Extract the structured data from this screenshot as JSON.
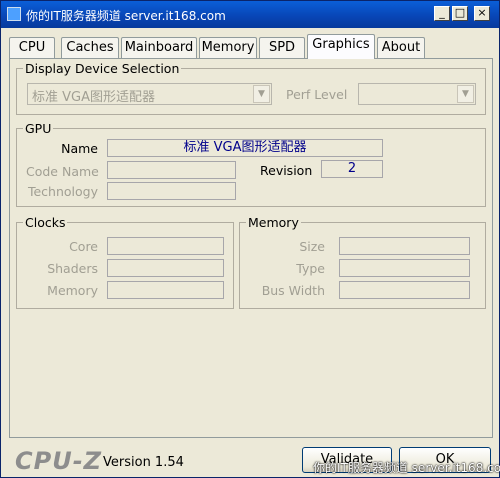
{
  "window": {
    "title": "你的IT服务器频道 server.it168.com"
  },
  "tabs": [
    {
      "label": "CPU"
    },
    {
      "label": "Caches"
    },
    {
      "label": "Mainboard"
    },
    {
      "label": "Memory"
    },
    {
      "label": "SPD"
    },
    {
      "label": "Graphics"
    },
    {
      "label": "About"
    }
  ],
  "active_tab": "Graphics",
  "display_selection": {
    "legend": "Display Device Selection",
    "device": "标准 VGA图形适配器",
    "perf_level_label": "Perf Level",
    "perf_level_value": ""
  },
  "gpu": {
    "legend": "GPU",
    "name_label": "Name",
    "name_value": "标准 VGA图形适配器",
    "code_name_label": "Code Name",
    "code_name_value": "",
    "revision_label": "Revision",
    "revision_value": "2",
    "technology_label": "Technology",
    "technology_value": ""
  },
  "clocks": {
    "legend": "Clocks",
    "core_label": "Core",
    "shaders_label": "Shaders",
    "memory_label": "Memory"
  },
  "memory": {
    "legend": "Memory",
    "size_label": "Size",
    "type_label": "Type",
    "bus_width_label": "Bus Width"
  },
  "footer": {
    "logo": "CPU-Z",
    "version": "Version 1.54",
    "validate_label": "Validate",
    "ok_label": "OK",
    "watermark": "你的IT服务器频道 server.it168.com"
  }
}
